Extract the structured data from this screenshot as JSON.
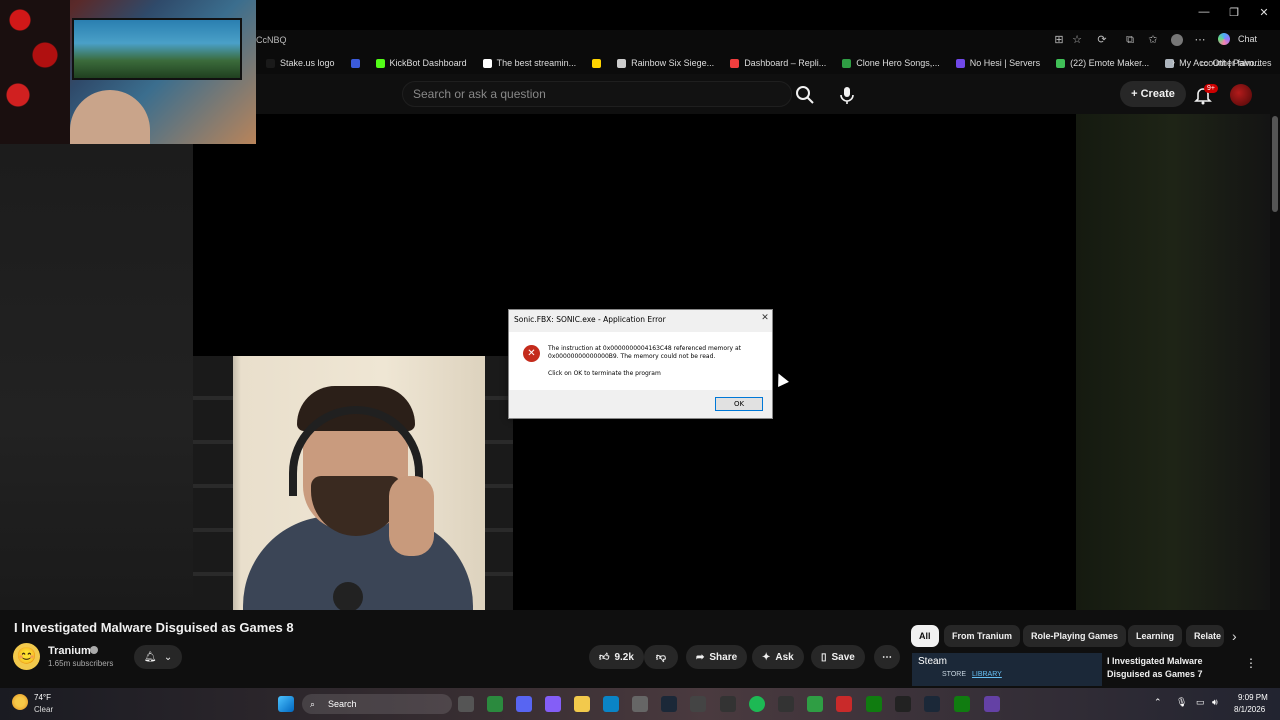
{
  "browser": {
    "url_fragment": "CcNBQ",
    "chat_label": "Chat",
    "other_favorites": "Other favorites",
    "bookmarks": [
      {
        "label": "Stake.us logo",
        "color": "#1a1a1a"
      },
      {
        "label": "",
        "color": "#3b5bdb"
      },
      {
        "label": "KickBot Dashboard",
        "color": "#53fc18"
      },
      {
        "label": "The best streamin...",
        "color": "#ffffff"
      },
      {
        "label": "",
        "color": "#ffd400"
      },
      {
        "label": "Rainbow Six Siege...",
        "color": "#cccccc"
      },
      {
        "label": "Dashboard – Repli...",
        "color": "#f03e3e"
      },
      {
        "label": "Clone Hero Songs,...",
        "color": "#2f9e44"
      },
      {
        "label": "No Hesi | Servers",
        "color": "#7048e8"
      },
      {
        "label": "(22) Emote Maker...",
        "color": "#40c057"
      },
      {
        "label": "My Account | Palm...",
        "color": "#adb5bd"
      }
    ]
  },
  "youtube": {
    "search_placeholder": "Search or ask a question",
    "create_label": "Create",
    "notif_count": "9+"
  },
  "dialog": {
    "title": "Sonic.FBX: SONIC.exe - Application Error",
    "message": "The instruction at 0x0000000004163C48 referenced memory at 0x00000000000000B9. The memory could not be read.",
    "sub": "Click on OK to terminate the program",
    "ok_label": "OK",
    "icon_glyph": "✕"
  },
  "video": {
    "title": "I Investigated Malware Disguised as Games 8",
    "channel": "Tranium",
    "subscribers": "1.65m subscribers",
    "likes": "9.2k",
    "share_label": "Share",
    "ask_label": "Ask",
    "save_label": "Save"
  },
  "chips": [
    "All",
    "From Tranium",
    "Role-Playing Games",
    "Learning",
    "Relate"
  ],
  "related": {
    "thumb_app": "Steam",
    "thumb_store": "STORE",
    "thumb_library": "LIBRARY",
    "title": "I Investigated Malware Disguised as Games 7"
  },
  "taskbar": {
    "temp": "74°F",
    "weather": "Clear",
    "search_label": "Search",
    "time": "9:09 PM",
    "date": "8/1/2026"
  }
}
